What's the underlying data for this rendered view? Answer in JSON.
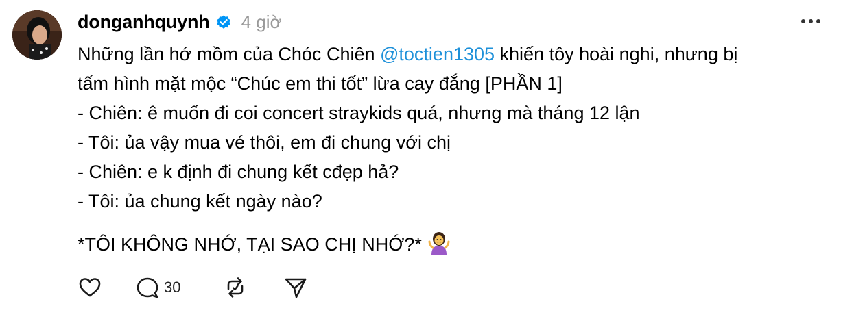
{
  "post": {
    "username": "donganhquynh",
    "time": "4 giờ",
    "line1_text": "Những lần hớ mồm của Chóc Chiên ",
    "line1_mention": "@toctien1305",
    "line1_tail": " khiến tôy hoài nghi, nhưng bị",
    "line2": "tấm hình mặt mộc “Chúc em thi tốt” lừa cay đắng [PHẦN 1]",
    "line3": "- Chiên: ê muốn đi coi concert straykids quá, nhưng mà tháng 12 lận",
    "line4": "- Tôi: ủa vậy mua vé thôi, em đi chung với chị",
    "line5": "- Chiên: e k định đi chung kết cđẹp hả?",
    "line6": "- Tôi: ủa chung kết ngày nào?",
    "line7": "*TÔI KHÔNG NHỚ, TẠI SAO CHỊ NHỚ?*"
  },
  "actions": {
    "reply_count": "30"
  },
  "icons": {
    "verified": "verified-badge-icon",
    "more": "more-icon",
    "like": "heart-icon",
    "reply": "comment-icon",
    "repost": "repost-icon",
    "share": "send-icon",
    "emoji": "person-shrugging-emoji"
  },
  "colors": {
    "mention": "#1d90d9",
    "muted": "#999999",
    "text": "#000000"
  }
}
